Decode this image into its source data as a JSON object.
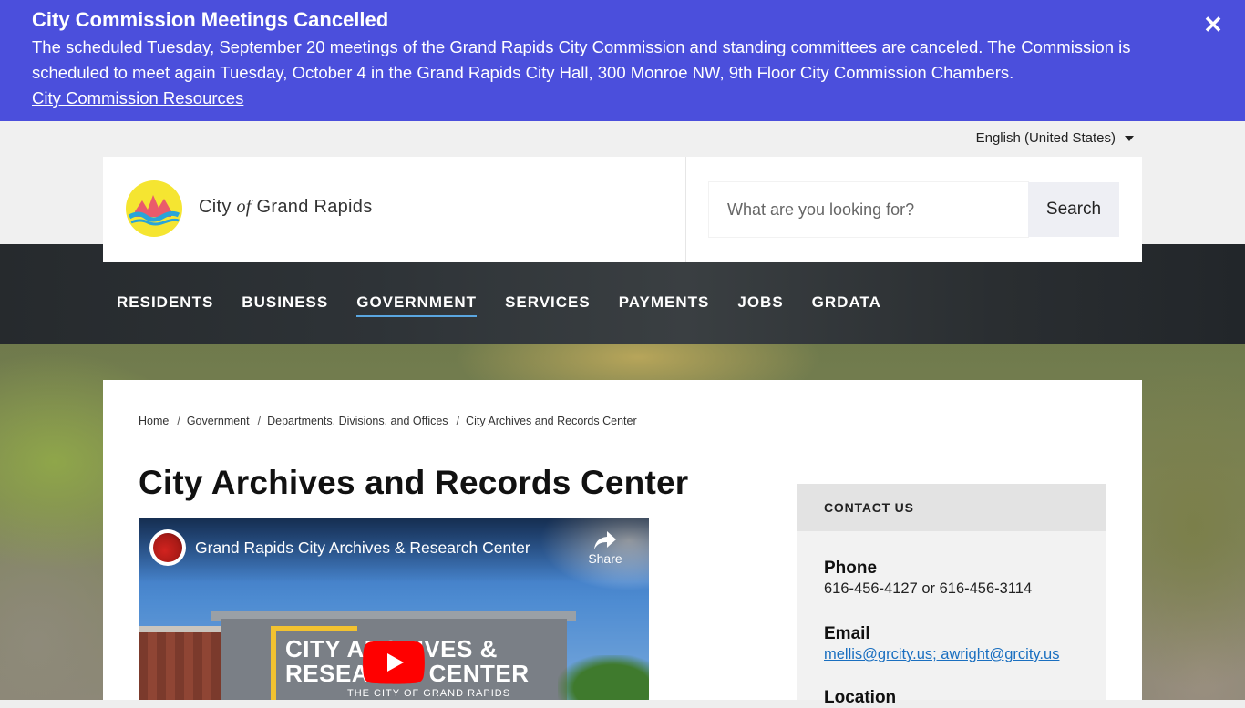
{
  "alert": {
    "title": "City Commission Meetings Cancelled",
    "body": "The scheduled Tuesday, September 20 meetings of the Grand Rapids City Commission and standing committees are canceled. The Commission is scheduled to meet again Tuesday, October 4 in the Grand Rapids City Hall, 300 Monroe NW, 9th Floor City Commission Chambers.",
    "link": "City Commission Resources",
    "close_icon": "close-icon",
    "color": "#4b4fdc"
  },
  "language": {
    "selected": "English (United States)"
  },
  "header": {
    "brand_pre": "City ",
    "brand_of": "of",
    "brand_post": " Grand Rapids",
    "search_placeholder": "What are you looking for?",
    "search_label": "Search"
  },
  "nav": {
    "items": [
      "RESIDENTS",
      "BUSINESS",
      "GOVERNMENT",
      "SERVICES",
      "PAYMENTS",
      "JOBS",
      "GRDATA"
    ],
    "active": "GOVERNMENT"
  },
  "breadcrumb": {
    "items": [
      "Home",
      "Government",
      "Departments, Divisions, and Offices",
      "City Archives and Records Center"
    ],
    "separator": "/"
  },
  "page": {
    "title": "City Archives and Records Center"
  },
  "video": {
    "title": "Grand Rapids City Archives & Research Center",
    "share": "Share",
    "thumb_line1": "CITY ARCHIVES &",
    "thumb_line2": "RESEARCH CENTER",
    "thumb_line3": "THE CITY OF GRAND RAPIDS"
  },
  "contact": {
    "heading": "CONTACT US",
    "phone_label": "Phone",
    "phone_value": "616-456-4127 or 616-456-3114",
    "email_label": "Email",
    "email_value": "mellis@grcity.us; awright@grcity.us",
    "location_label": "Location"
  }
}
